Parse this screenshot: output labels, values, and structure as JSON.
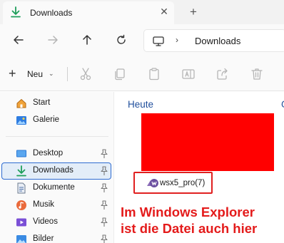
{
  "tab": {
    "title": "Downloads",
    "close": "✕",
    "new_tab": "+"
  },
  "address": {
    "separator": "›",
    "path": "Downloads"
  },
  "command_bar": {
    "new_label": "Neu",
    "new_chevron": "⌄"
  },
  "sidebar": {
    "items": [
      {
        "label": "Start",
        "icon": "home-icon",
        "pinned": false,
        "selected": false
      },
      {
        "label": "Galerie",
        "icon": "gallery-icon",
        "pinned": false,
        "selected": false
      },
      {
        "label": "Desktop",
        "icon": "desktop-icon",
        "pinned": true,
        "selected": false
      },
      {
        "label": "Downloads",
        "icon": "download-icon",
        "pinned": true,
        "selected": true
      },
      {
        "label": "Dokumente",
        "icon": "documents-icon",
        "pinned": true,
        "selected": false
      },
      {
        "label": "Musik",
        "icon": "music-icon",
        "pinned": true,
        "selected": false
      },
      {
        "label": "Videos",
        "icon": "videos-icon",
        "pinned": true,
        "selected": false
      },
      {
        "label": "Bilder",
        "icon": "pictures-icon",
        "pinned": true,
        "selected": false
      }
    ]
  },
  "content": {
    "group_heading": "Heute",
    "group_heading_next": "G",
    "file": {
      "name": "wsx5_pro(7)",
      "icon": "wsx5-app-icon"
    },
    "annotation": [
      "Im Windows Explorer",
      "ist die Datei auch hier"
    ]
  },
  "colors": {
    "accent": "#2e6bd1",
    "download_green": "#1e9e5a",
    "annotation_red": "#e41b1b",
    "redaction": "#ff0000"
  }
}
